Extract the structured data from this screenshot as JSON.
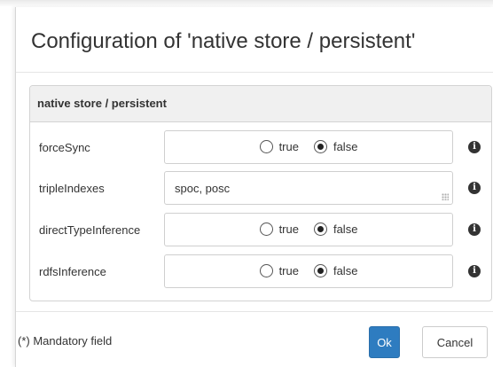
{
  "dialog": {
    "title": "Configuration of 'native store / persistent'",
    "panel_heading": "native store / persistent",
    "fields": [
      {
        "label": "forceSync",
        "type": "radio",
        "options": [
          "true",
          "false"
        ],
        "selected": "false"
      },
      {
        "label": "tripleIndexes",
        "type": "text",
        "value": "spoc, posc"
      },
      {
        "label": "directTypeInference",
        "type": "radio",
        "options": [
          "true",
          "false"
        ],
        "selected": "false"
      },
      {
        "label": "rdfsInference",
        "type": "radio",
        "options": [
          "true",
          "false"
        ],
        "selected": "false"
      }
    ],
    "info_icon_glyph": "i",
    "mandatory_note": "(*) Mandatory field",
    "ok_label": "Ok",
    "cancel_label": "Cancel"
  },
  "colors": {
    "primary_button": "#2e7cc0",
    "panel_heading_bg": "#f0f0f0"
  }
}
